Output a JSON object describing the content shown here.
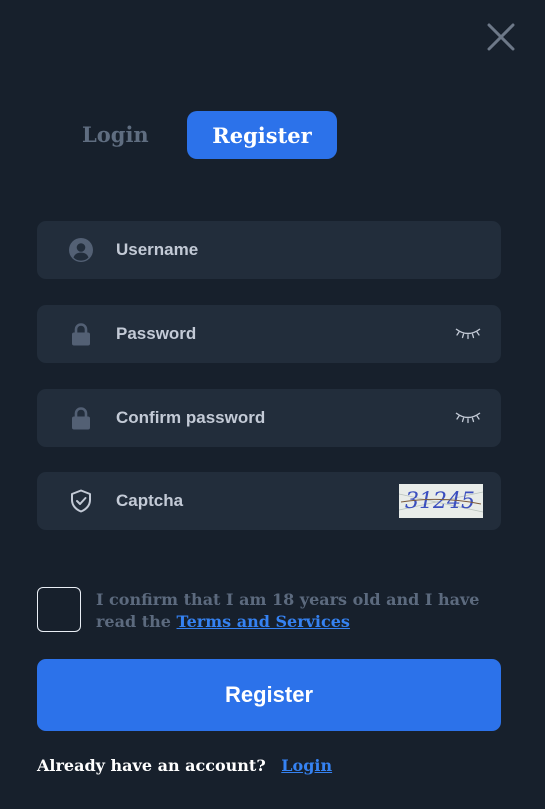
{
  "tabs": {
    "login": "Login",
    "register": "Register",
    "active": "register"
  },
  "form": {
    "username": {
      "placeholder": "Username",
      "value": "",
      "icon": "user-icon"
    },
    "password": {
      "placeholder": "Password",
      "value": "",
      "icon": "lock-icon",
      "toggle_icon": "eye-closed-icon"
    },
    "confirm_password": {
      "placeholder": "Confirm password",
      "value": "",
      "icon": "lock-icon",
      "toggle_icon": "eye-closed-icon"
    },
    "captcha": {
      "placeholder": "Captcha",
      "value": "",
      "icon": "shield-icon",
      "image_text": "31245"
    }
  },
  "agreement": {
    "checked": false,
    "text": "I confirm that I am 18 years old and I have read the",
    "link": "Terms and Services"
  },
  "register_button": "Register",
  "footer": {
    "question": "Already have an account?",
    "login_link": "Login"
  },
  "colors": {
    "background": "#17202c",
    "field": "#222d3b",
    "accent": "#2c72ea",
    "link": "#3582f2",
    "muted": "#5c6a7e"
  }
}
